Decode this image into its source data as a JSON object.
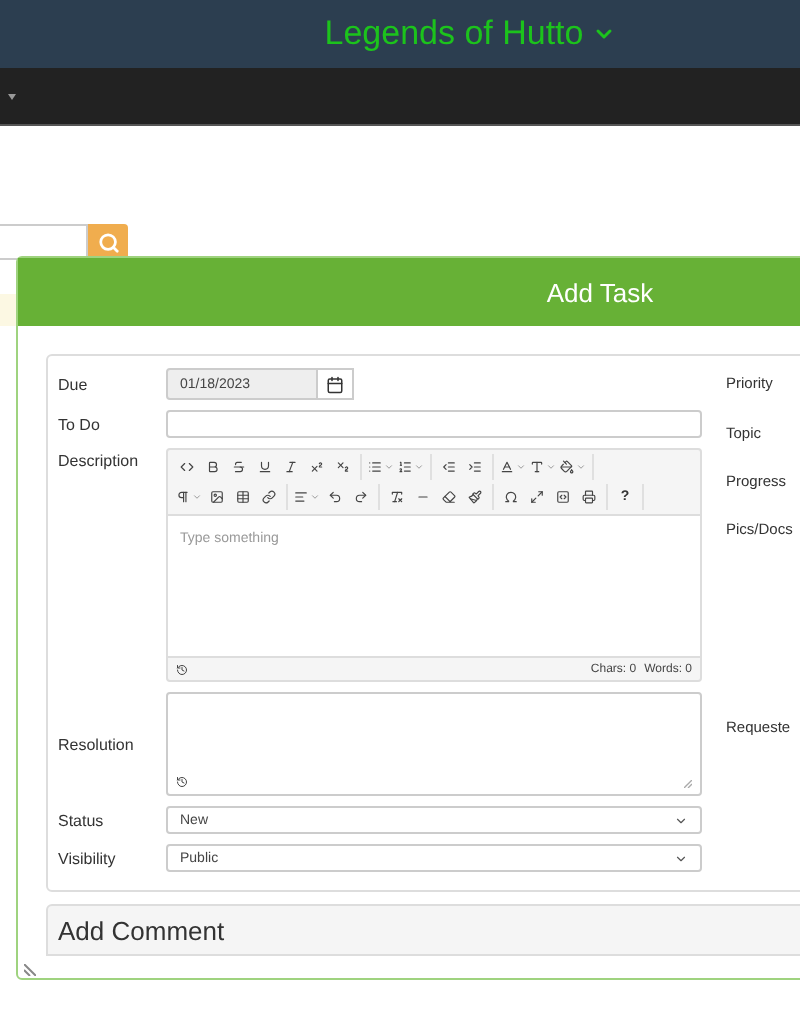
{
  "header": {
    "title": "Legends of Hutto"
  },
  "modal": {
    "title": "Add Task",
    "fields": [
      {
        "kind": "date",
        "label": "Due",
        "value": "01/18/2023"
      },
      {
        "kind": "text",
        "label": "To Do"
      },
      {
        "kind": "editor",
        "label": "Description",
        "placeholder": "Type something",
        "chars": "Chars: 0",
        "words": "Words: 0",
        "help": "?"
      },
      {
        "kind": "textarea",
        "label": "Resolution"
      },
      {
        "kind": "select",
        "label": "Status",
        "value": "New"
      },
      {
        "kind": "select",
        "label": "Visibility",
        "value": "Public"
      }
    ],
    "side_labels": [
      "Priority",
      "Topic",
      "Progress",
      "Pics/Docs",
      "Requeste"
    ],
    "comment_panel": {
      "title": "Add Comment"
    }
  }
}
